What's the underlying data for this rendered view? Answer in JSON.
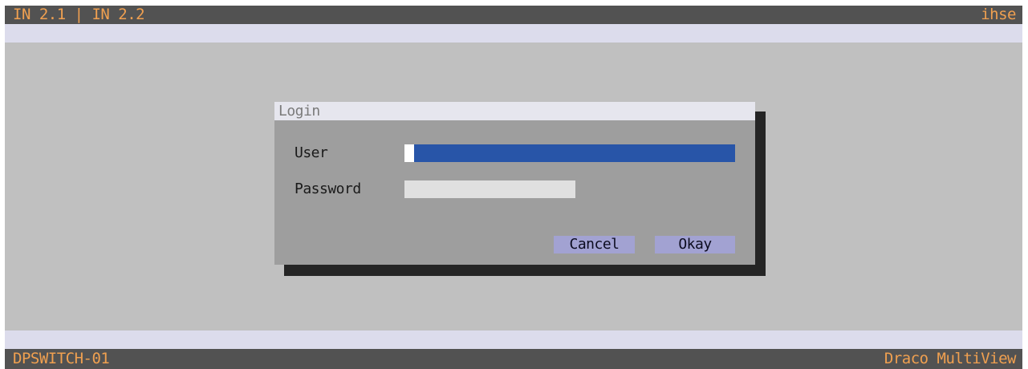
{
  "header": {
    "inputs_label": "IN 2.1 | IN 2.2",
    "brand": "ihse"
  },
  "footer": {
    "device_name": "DPSWITCH-01",
    "product": "Draco MultiView"
  },
  "login_dialog": {
    "title": "Login",
    "user_label": "User",
    "user_value": "",
    "password_label": "Password",
    "password_value": "",
    "cancel_label": "Cancel",
    "okay_label": "Okay"
  },
  "colors": {
    "bar_background": "#525252",
    "bar_text": "#f0a050",
    "stripe": "#dcdcec",
    "desktop": "#c0c0c0",
    "dialog_body": "#9e9e9e",
    "active_field": "#2855a8",
    "inactive_field": "#e0e0e0",
    "button": "#a2a2d2"
  }
}
